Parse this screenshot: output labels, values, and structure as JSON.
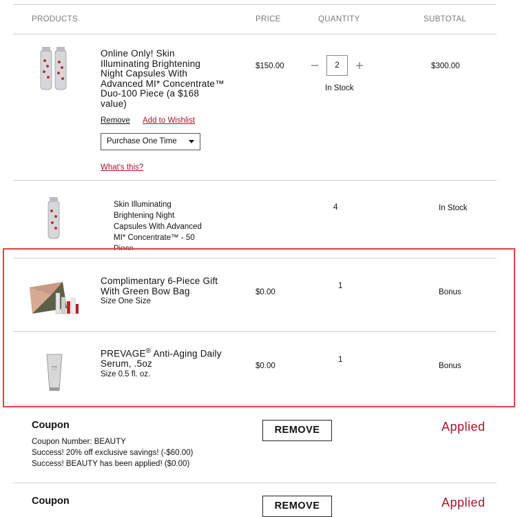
{
  "table": {
    "headers": {
      "products": "PRODUCTS",
      "price": "PRICE",
      "quantity": "QUANTITY",
      "subtotal": "SUBTOTAL"
    }
  },
  "items": [
    {
      "name_lines": [
        "Online Only! Skin",
        "Illuminating Brightening",
        "Night Capsules With",
        "Advanced MI* Concentrate™",
        "Duo-100 Piece (a $168",
        "value)"
      ],
      "price": "$150.00",
      "quantity": "2",
      "stock": "In Stock",
      "subtotal": "$300.00",
      "remove_label": "Remove",
      "wishlist_label": "Add to Wishlist",
      "purchase_option": "Purchase One Time",
      "whats_this": "What's this?"
    },
    {
      "name_lines": [
        "Skin Illuminating",
        "Brightening Night",
        "Capsules With Advanced",
        "MI* Concentrate™ - 50",
        "Piece"
      ],
      "quantity": "4",
      "stock": "In Stock"
    },
    {
      "name_lines": [
        "Complimentary 6-Piece Gift",
        "With Green Bow Bag"
      ],
      "size": "Size One Size",
      "price": "$0.00",
      "quantity": "1",
      "subtotal": "Bonus"
    },
    {
      "name_prefix": "PREVAGE",
      "name_reg": "®",
      "name_suffix": " Anti-Aging Daily",
      "name_line2": "Serum, .5oz",
      "size": "Size 0.5 fl. oz.",
      "price": "$0.00",
      "quantity": "1",
      "subtotal": "Bonus"
    }
  ],
  "coupons": [
    {
      "title": "Coupon",
      "lines": [
        "Coupon Number: BEAUTY",
        "Success! 20% off exclusive savings! (-$60.00)",
        "Success! BEAUTY has been applied! ($0.00)"
      ],
      "button": "REMOVE",
      "status": "Applied"
    },
    {
      "title": "Coupon",
      "button": "REMOVE",
      "status": "Applied"
    }
  ],
  "icons": {
    "minus": "minus-icon",
    "plus": "plus-icon",
    "caret": "chevron-down-icon"
  },
  "colors": {
    "accent": "#a7142a",
    "highlight": "#e0423f",
    "rule": "#cfcfcf"
  }
}
